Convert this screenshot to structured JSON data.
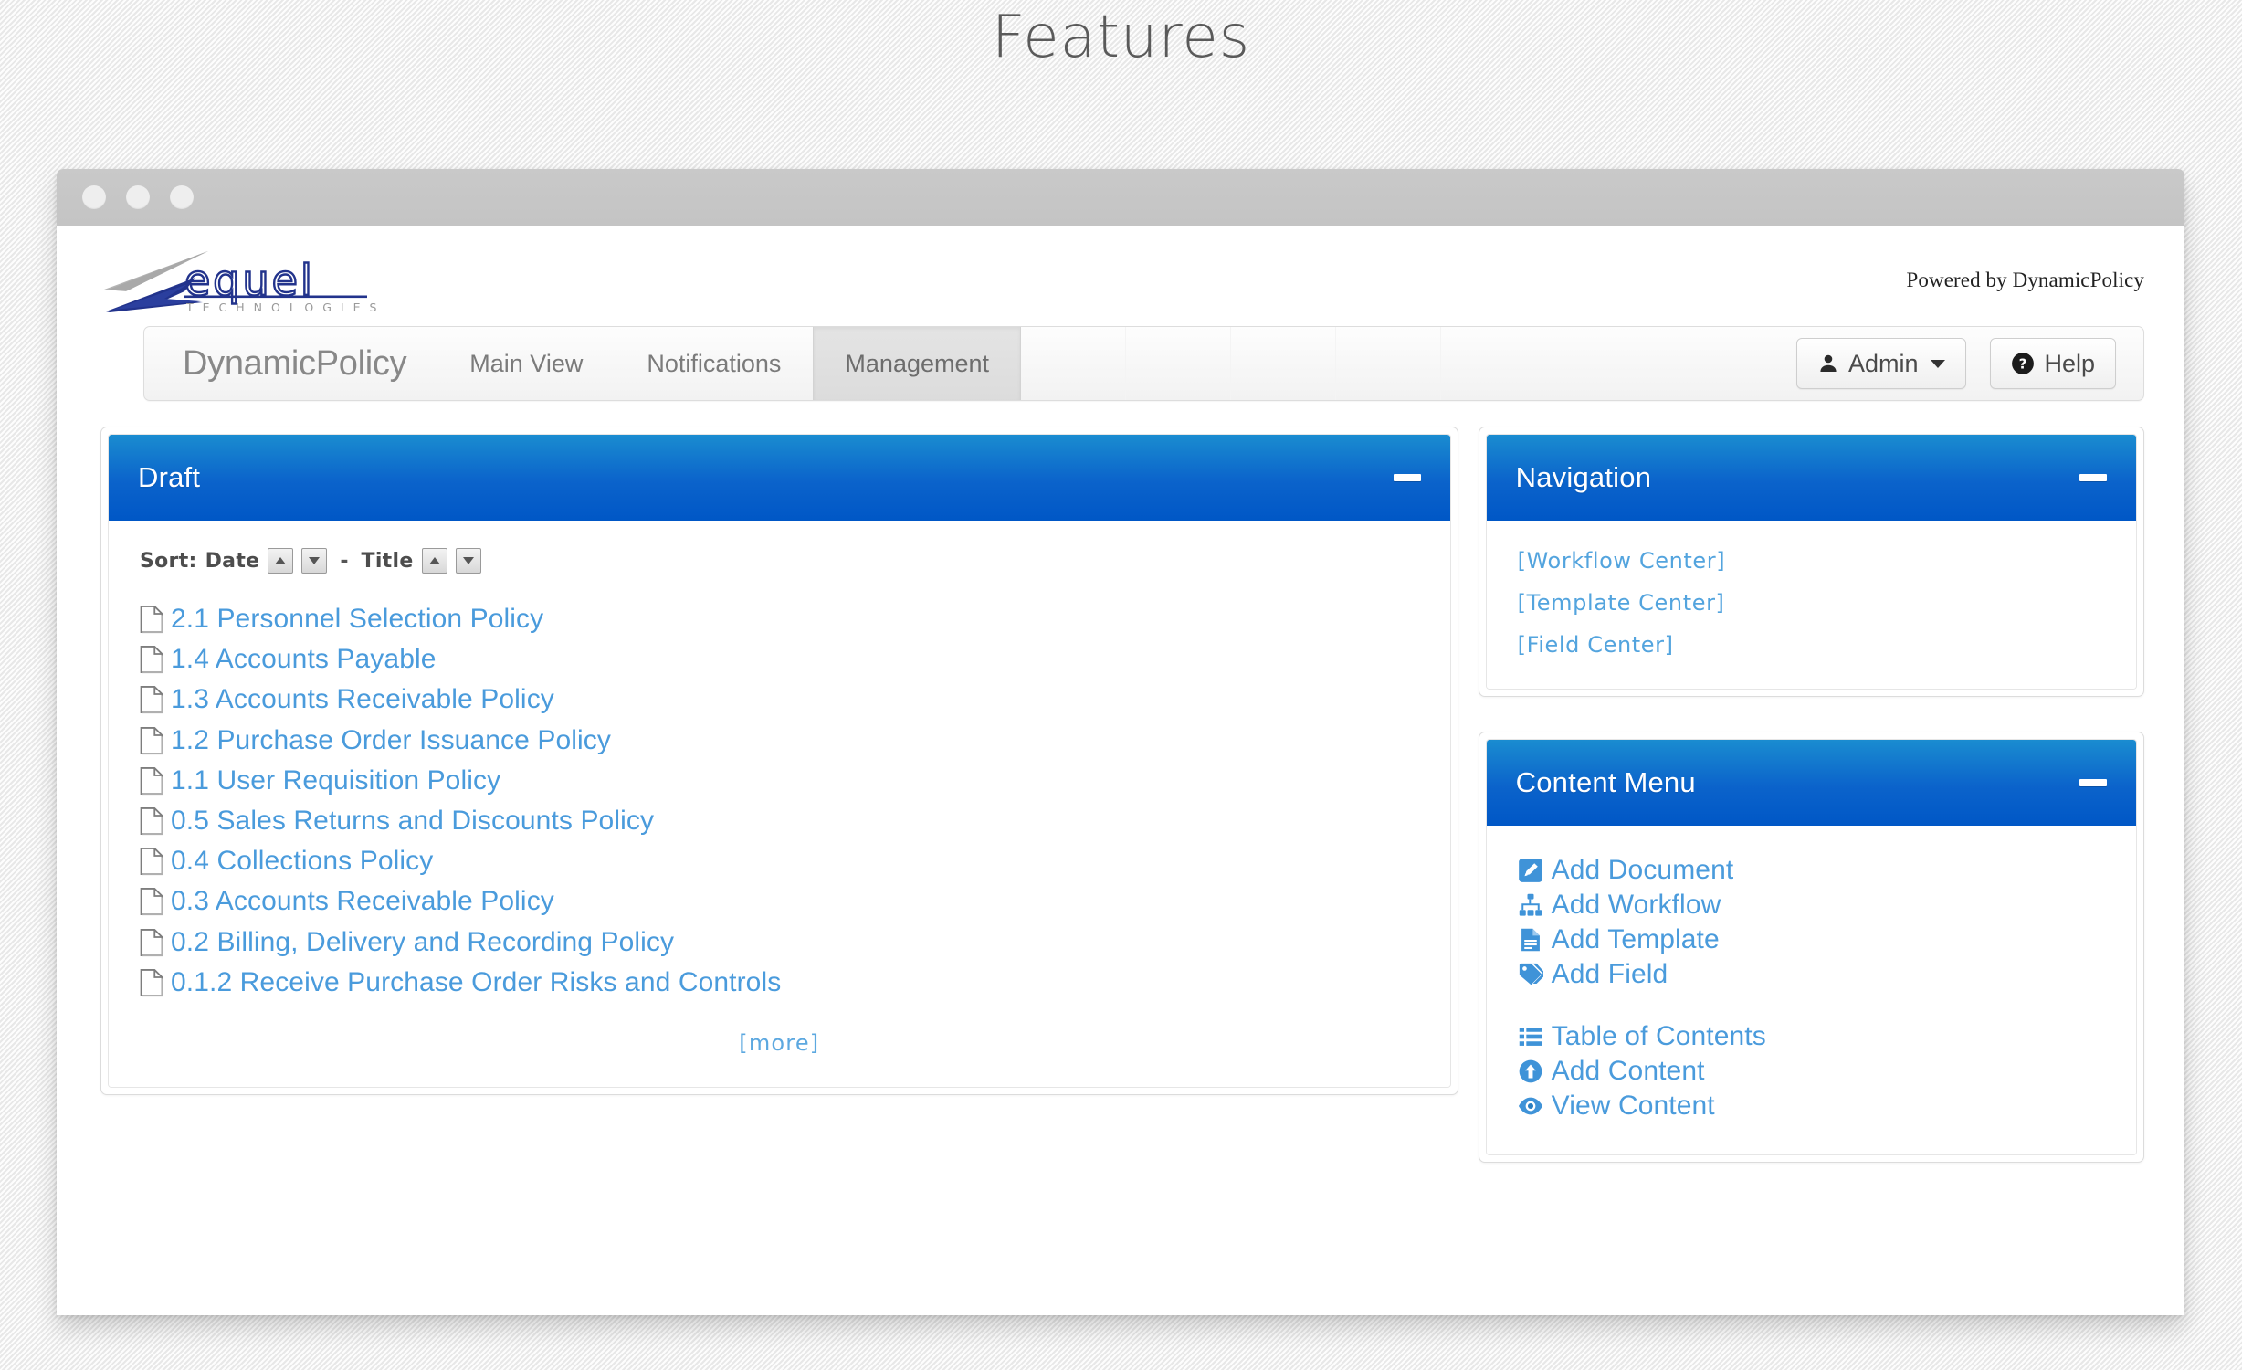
{
  "page": {
    "title": "Features"
  },
  "browser": {
    "dots": [
      "dot-1",
      "dot-2",
      "dot-3"
    ]
  },
  "brand": {
    "logo_text": "zequel",
    "logo_subtext": "TECHNOLOGIES",
    "powered_by": "Powered by DynamicPolicy"
  },
  "navbar": {
    "brand": "DynamicPolicy",
    "tabs": [
      {
        "label": "Main View",
        "active": false
      },
      {
        "label": "Notifications",
        "active": false
      },
      {
        "label": "Management",
        "active": true
      }
    ],
    "admin_button": "Admin",
    "help_button": "Help"
  },
  "draft_panel": {
    "title": "Draft",
    "sort": {
      "label": "Sort:",
      "date_label": "Date",
      "separator": "-",
      "title_label": "Title",
      "asc_glyph": "▲",
      "desc_glyph": "▼"
    },
    "documents": [
      "2.1 Personnel Selection Policy",
      "1.4 Accounts Payable",
      "1.3 Accounts Receivable Policy",
      "1.2 Purchase Order Issuance Policy",
      "1.1 User Requisition Policy",
      "0.5 Sales Returns and Discounts Policy",
      "0.4 Collections Policy",
      "0.3 Accounts Receivable Policy",
      "0.2 Billing, Delivery and Recording Policy",
      "0.1.2 Receive Purchase Order Risks and Controls"
    ],
    "more_link": "[more]"
  },
  "navigation_panel": {
    "title": "Navigation",
    "links": [
      "[Workflow Center]",
      "[Template Center]",
      "[Field Center]"
    ]
  },
  "content_menu_panel": {
    "title": "Content Menu",
    "items": [
      {
        "label": "Add Document",
        "icon": "pencil-square-icon",
        "spaced": false
      },
      {
        "label": "Add Workflow",
        "icon": "sitemap-icon",
        "spaced": false
      },
      {
        "label": "Add Template",
        "icon": "file-text-icon",
        "spaced": false
      },
      {
        "label": "Add Field",
        "icon": "tag-icon",
        "spaced": false
      },
      {
        "label": "Table of Contents",
        "icon": "list-icon",
        "spaced": true
      },
      {
        "label": "Add Content",
        "icon": "arrow-up-circle-icon",
        "spaced": false
      },
      {
        "label": "View Content",
        "icon": "eye-icon",
        "spaced": false
      }
    ]
  },
  "colors": {
    "panel_header_top": "#1a8cd0",
    "panel_header_bottom": "#0057c6",
    "link_blue": "#4a9bdc",
    "logo_blue": "#22338c",
    "page_background": "#f4f4f4"
  }
}
